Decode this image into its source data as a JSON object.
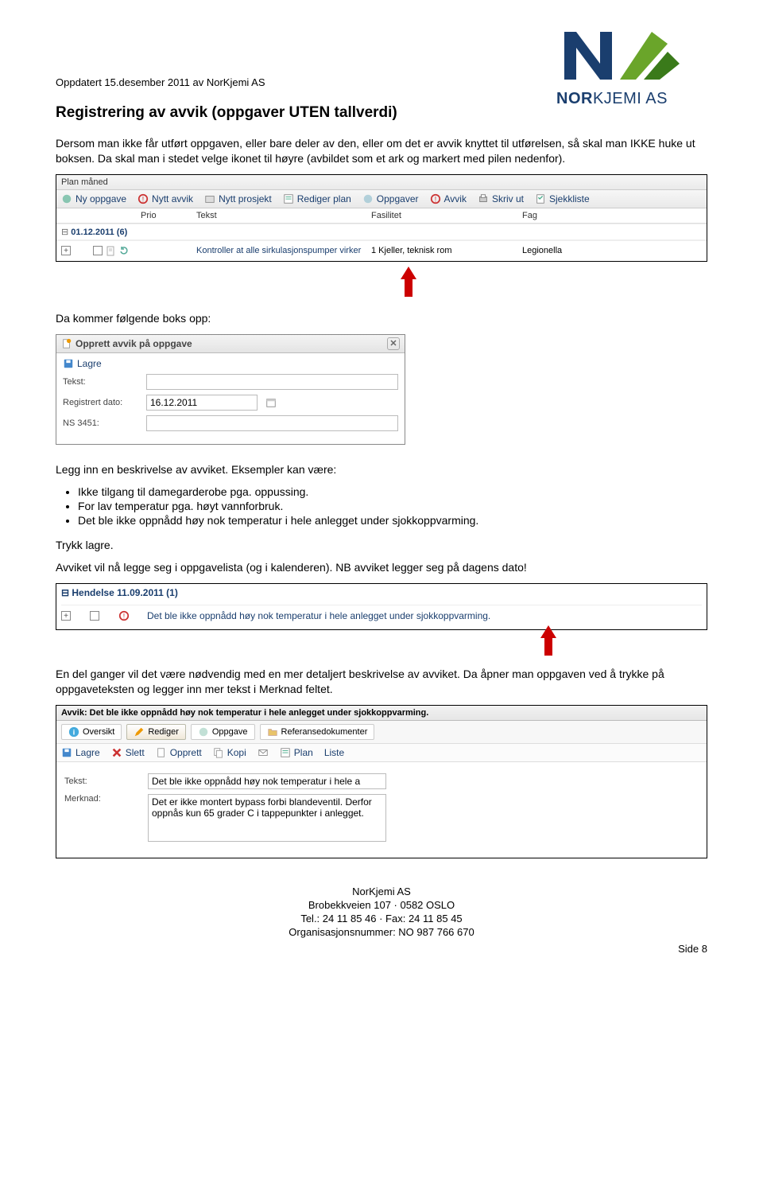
{
  "meta": {
    "updated": "Oppdatert 15.desember 2011 av NorKjemi AS"
  },
  "logo": {
    "bold": "NOR",
    "thin": "KJEMI AS"
  },
  "h1": "Registrering av avvik (oppgaver UTEN tallverdi)",
  "p1": "Dersom man ikke får utført oppgaven, eller bare deler av den, eller om det er avvik knyttet til utførelsen, så skal man IKKE huke ut boksen. Da skal man i stedet velge ikonet til høyre (avbildet som et ark og markert med pilen nedenfor).",
  "panel1": {
    "title": "Plan måned",
    "toolbar": {
      "ny_oppgave": "Ny oppgave",
      "nytt_avvik": "Nytt avvik",
      "nytt_prosjekt": "Nytt prosjekt",
      "rediger_plan": "Rediger plan",
      "oppgaver": "Oppgaver",
      "avvik": "Avvik",
      "skriv_ut": "Skriv ut",
      "sjekkliste": "Sjekkliste"
    },
    "headers": {
      "prio": "Prio",
      "tekst": "Tekst",
      "fasilitet": "Fasilitet",
      "fag": "Fag"
    },
    "group": "01.12.2011 (6)",
    "row": {
      "tekst": "Kontroller at alle sirkulasjonspumper virker",
      "fasilitet": "1 Kjeller, teknisk rom",
      "fag": "Legionella"
    }
  },
  "p2": "Da kommer følgende boks opp:",
  "dlg": {
    "title": "Opprett avvik på oppgave",
    "lagre": "Lagre",
    "fields": {
      "tekst_label": "Tekst:",
      "tekst_value": "",
      "dato_label": "Registrert dato:",
      "dato_value": "16.12.2011",
      "ns_label": "NS 3451:",
      "ns_value": ""
    }
  },
  "p3": "Legg inn en beskrivelse av avviket. Eksempler kan være:",
  "bullets": [
    "Ikke tilgang til damegarderobe pga. oppussing.",
    "For lav temperatur pga. høyt vannforbruk.",
    "Det ble ikke oppnådd høy nok temperatur i hele anlegget under sjokkoppvarming."
  ],
  "p4a": "Trykk lagre.",
  "p4b": "Avviket vil nå legge seg i oppgavelista (og i kalenderen). NB avviket legger seg på dagens dato!",
  "hendelse": {
    "hdr": "Hendelse 11.09.2011 (1)",
    "txt": "Det ble ikke oppnådd høy nok temperatur i hele anlegget under sjokkoppvarming."
  },
  "p5": "En del ganger vil det være nødvendig med en mer detaljert beskrivelse av avviket. Da åpner man oppgaven ved å trykke på oppgaveteksten og legger inn mer tekst i Merknad feltet.",
  "avvik": {
    "head": "Avvik: Det ble ikke oppnådd høy nok temperatur i hele anlegget under sjokkoppvarming.",
    "tabs": {
      "oversikt": "Oversikt",
      "rediger": "Rediger",
      "oppgave": "Oppgave",
      "ref": "Referansedokumenter"
    },
    "tools": {
      "lagre": "Lagre",
      "slett": "Slett",
      "opprett": "Opprett",
      "kopi": "Kopi",
      "plan": "Plan",
      "liste": "Liste"
    },
    "fields": {
      "tekst_label": "Tekst:",
      "tekst_value": "Det ble ikke oppnådd høy nok temperatur i hele a",
      "merknad_label": "Merknad:",
      "merknad_value": "Det er ikke montert bypass forbi blandeventil. Derfor oppnås kun 65 grader C i tappepunkter i anlegget."
    }
  },
  "footer": {
    "l1": "NorKjemi AS",
    "l2": "Brobekkveien 107 · 0582 OSLO",
    "l3": "Tel.: 24 11 85 46 · Fax: 24 11 85 45",
    "l4": "Organisasjonsnummer: NO 987 766 670",
    "side": "Side 8"
  }
}
